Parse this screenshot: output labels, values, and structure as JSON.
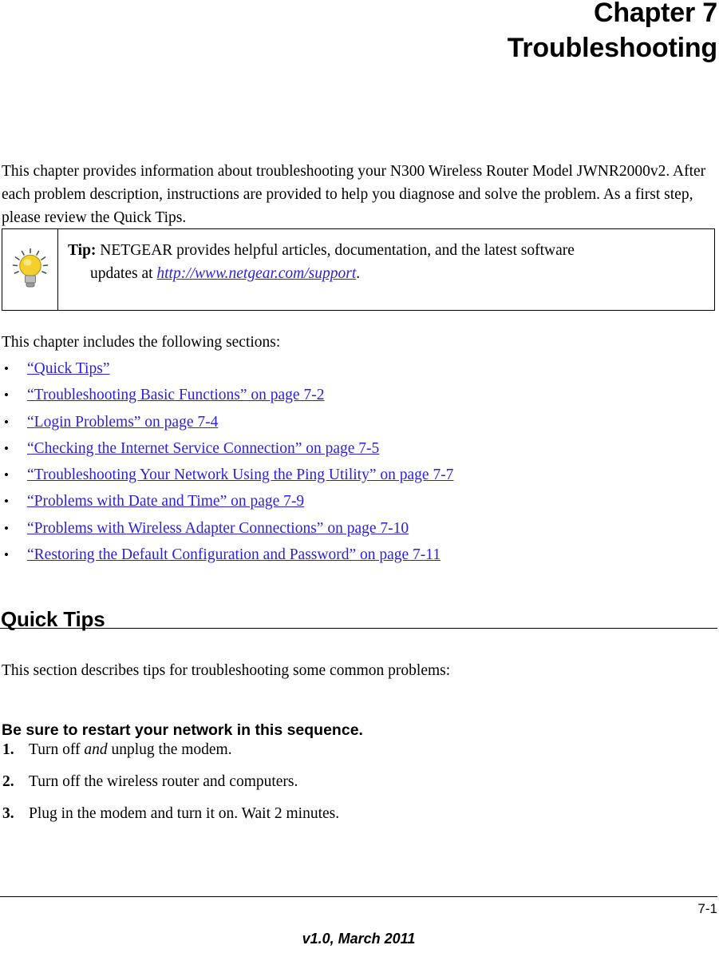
{
  "header": {
    "chapter_number": "Chapter 7",
    "chapter_title": "Troubleshooting"
  },
  "intro": {
    "paragraph": "This chapter provides information about troubleshooting your N300 Wireless Router Model JWNR2000v2. After each problem description, instructions are provided to help you diagnose and solve the problem. As a first step, please review the Quick Tips."
  },
  "tip": {
    "icon": "lightbulb-icon",
    "label": "Tip:",
    "text_line1": "NETGEAR provides helpful articles, documentation, and the latest software",
    "text_line2_prefix": "updates at ",
    "link_text": "http://www.netgear.com/support",
    "text_line2_suffix": ".",
    "link_color": "#2a1fe0"
  },
  "sections": {
    "intro_line": "This chapter includes the following sections:",
    "bullet_marker": "•",
    "items": [
      {
        "label": "“Quick Tips”"
      },
      {
        "label": "“Troubleshooting Basic Functions” on page 7-2"
      },
      {
        "label": "“Login Problems” on page 7-4"
      },
      {
        "label": "“Checking the Internet Service Connection” on page 7-5"
      },
      {
        "label": "“Troubleshooting Your Network Using the Ping Utility” on page 7-7"
      },
      {
        "label": "“Problems with Date and Time” on page 7-9"
      },
      {
        "label": "“Problems with Wireless Adapter Connections” on page 7-10"
      },
      {
        "label": "“Restoring the Default Configuration and Password” on page 7-11"
      }
    ]
  },
  "quick_tips": {
    "heading": "Quick Tips",
    "intro": "This section describes tips for troubleshooting some common problems:",
    "subheading": "Be sure to restart your network in this sequence.",
    "steps": [
      {
        "number": "1.",
        "text_before": "Turn off ",
        "emphasis": "and",
        "text_after": " unplug the modem."
      },
      {
        "number": "2.",
        "text_before": "Turn off the wireless router and computers.",
        "emphasis": "",
        "text_after": ""
      },
      {
        "number": "3.",
        "text_before": "Plug in the modem and turn it on. Wait 2 minutes.",
        "emphasis": "",
        "text_after": ""
      }
    ]
  },
  "footer": {
    "page_number": "7-1",
    "version": "v1.0, March 2011"
  }
}
